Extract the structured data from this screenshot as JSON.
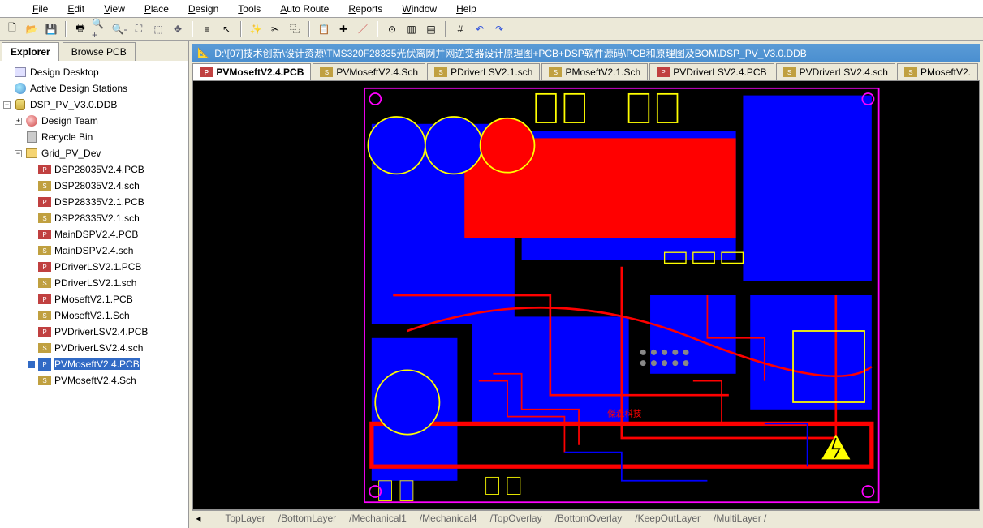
{
  "menu": [
    "File",
    "Edit",
    "View",
    "Place",
    "Design",
    "Tools",
    "Auto Route",
    "Reports",
    "Window",
    "Help"
  ],
  "toolbar_icons": [
    "new",
    "open",
    "save",
    "print",
    "zoom-in",
    "zoom-out",
    "zoom-fit",
    "zoom-sel",
    "pan",
    "layers",
    "select",
    "wizard",
    "cut",
    "copy",
    "paste",
    "cross",
    "track",
    "via",
    "comp1",
    "comp2",
    "grid",
    "undo",
    "redo"
  ],
  "left_tabs": [
    "Explorer",
    "Browse PCB"
  ],
  "tree": {
    "root1": "Design Desktop",
    "root2": "Active Design Stations",
    "root3": "DSP_PV_V3.0.DDB",
    "root3_children": {
      "c1": "Design Team",
      "c2": "Recycle Bin",
      "c3": "Grid_PV_Dev",
      "files": [
        {
          "name": "DSP28035V2.4.PCB",
          "type": "pcb"
        },
        {
          "name": "DSP28035V2.4.sch",
          "type": "sch"
        },
        {
          "name": "DSP28335V2.1.PCB",
          "type": "pcb"
        },
        {
          "name": "DSP28335V2.1.sch",
          "type": "sch"
        },
        {
          "name": "MainDSPV2.4.PCB",
          "type": "pcb"
        },
        {
          "name": "MainDSPV2.4.sch",
          "type": "sch"
        },
        {
          "name": "PDriverLSV2.1.PCB",
          "type": "pcb"
        },
        {
          "name": "PDriverLSV2.1.sch",
          "type": "sch"
        },
        {
          "name": "PMoseftV2.1.PCB",
          "type": "pcb"
        },
        {
          "name": "PMoseftV2.1.Sch",
          "type": "sch"
        },
        {
          "name": "PVDriverLSV2.4.PCB",
          "type": "pcb"
        },
        {
          "name": "PVDriverLSV2.4.sch",
          "type": "sch"
        },
        {
          "name": "PVMoseftV2.4.PCB",
          "type": "pcb",
          "selected": true
        },
        {
          "name": "PVMoseftV2.4.Sch",
          "type": "sch"
        }
      ]
    }
  },
  "title_path": "D:\\[07]技术创新\\设计资源\\TMS320F28335光伏离网并网逆变器设计原理图+PCB+DSP软件源码\\PCB和原理图及BOM\\DSP_PV_V3.0.DDB",
  "doc_tabs": [
    {
      "label": "PVMoseftV2.4.PCB",
      "active": true,
      "type": "pcb"
    },
    {
      "label": "PVMoseftV2.4.Sch",
      "type": "sch"
    },
    {
      "label": "PDriverLSV2.1.sch",
      "type": "sch"
    },
    {
      "label": "PMoseftV2.1.Sch",
      "type": "sch"
    },
    {
      "label": "PVDriverLSV2.4.PCB",
      "type": "pcb"
    },
    {
      "label": "PVDriverLSV2.4.sch",
      "type": "sch"
    },
    {
      "label": "PMoseftV2.",
      "type": "sch"
    }
  ],
  "board_text": "傑森科技",
  "layer_tabs": [
    "TopLayer",
    "BottomLayer",
    "Mechanical1",
    "Mechanical4",
    "TopOverlay",
    "BottomOverlay",
    "KeepOutLayer",
    "MultiLayer"
  ]
}
